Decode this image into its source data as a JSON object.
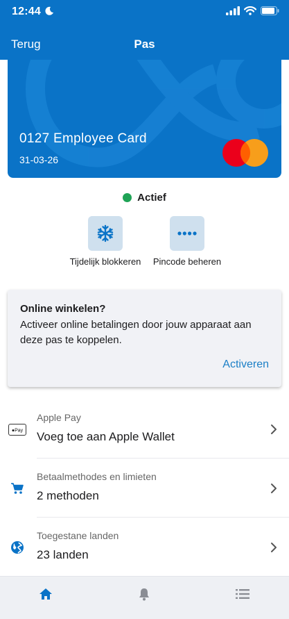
{
  "status_bar": {
    "time": "12:44"
  },
  "nav": {
    "back_label": "Terug",
    "title": "Pas"
  },
  "card": {
    "name": "0127 Employee Card",
    "expiry": "31-03-26"
  },
  "card_status": {
    "label": "Actief",
    "color": "#1fa356"
  },
  "actions": [
    {
      "label": "Tijdelijk blokkeren",
      "icon": "snowflake-icon"
    },
    {
      "label": "Pincode beheren",
      "icon": "pin-dots-icon"
    }
  ],
  "promo": {
    "title": "Online winkelen?",
    "body": "Activeer online betalingen door jouw apparaat aan deze pas te koppelen.",
    "action": "Activeren"
  },
  "list": [
    {
      "subtitle": "Apple Pay",
      "title": "Voeg toe aan Apple Wallet",
      "icon": "apple-pay-icon"
    },
    {
      "subtitle": "Betaalmethodes en limieten",
      "title": "2 methoden",
      "icon": "cart-icon"
    },
    {
      "subtitle": "Toegestane landen",
      "title": "23 landen",
      "icon": "globe-icon"
    }
  ],
  "tabbar": {
    "items": [
      "home-icon",
      "bell-icon",
      "list-icon"
    ],
    "active_color": "#0a73c7"
  },
  "colors": {
    "brand": "#0a73c7",
    "accent_text": "#1b7fc6"
  }
}
